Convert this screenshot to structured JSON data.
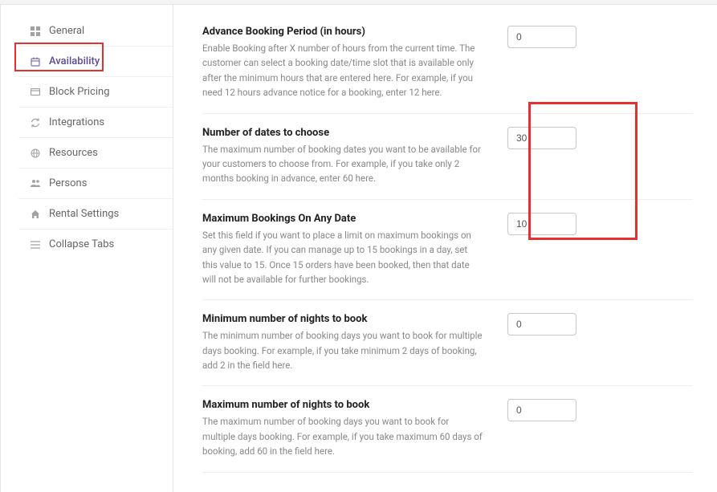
{
  "sidebar": {
    "items": [
      {
        "label": "General"
      },
      {
        "label": "Availability"
      },
      {
        "label": "Block Pricing"
      },
      {
        "label": "Integrations"
      },
      {
        "label": "Resources"
      },
      {
        "label": "Persons"
      },
      {
        "label": "Rental Settings"
      },
      {
        "label": "Collapse Tabs"
      }
    ]
  },
  "settings": {
    "advance_booking": {
      "title": "Advance Booking Period (in hours)",
      "desc": "Enable Booking after X number of hours from the current time. The customer can select a booking date/time slot that is available only after the minimum hours that are entered here. For example, if you need 12 hours advance notice for a booking, enter 12 here.",
      "value": "0"
    },
    "dates_to_choose": {
      "title": "Number of dates to choose",
      "desc": "The maximum number of booking dates you want to be available for your customers to choose from. For example, if you take only 2 months booking in advance, enter 60 here.",
      "value": "30"
    },
    "max_bookings": {
      "title": "Maximum Bookings On Any Date",
      "desc": "Set this field if you want to place a limit on maximum bookings on any given date. If you can manage up to 15 bookings in a day, set this value to 15. Once 15 orders have been booked, then that date will not be available for further bookings.",
      "value": "10"
    },
    "min_nights": {
      "title": "Minimum number of nights to book",
      "desc": "The minimum number of booking days you want to book for multiple days booking. For example, if you take minimum 2 days of booking, add 2 in the field here.",
      "value": "0"
    },
    "max_nights": {
      "title": "Maximum number of nights to book",
      "desc": "The maximum number of booking days you want to book for multiple days booking. For example, if you take maximum 60 days of booking, add 60 in the field here.",
      "value": "0"
    }
  }
}
